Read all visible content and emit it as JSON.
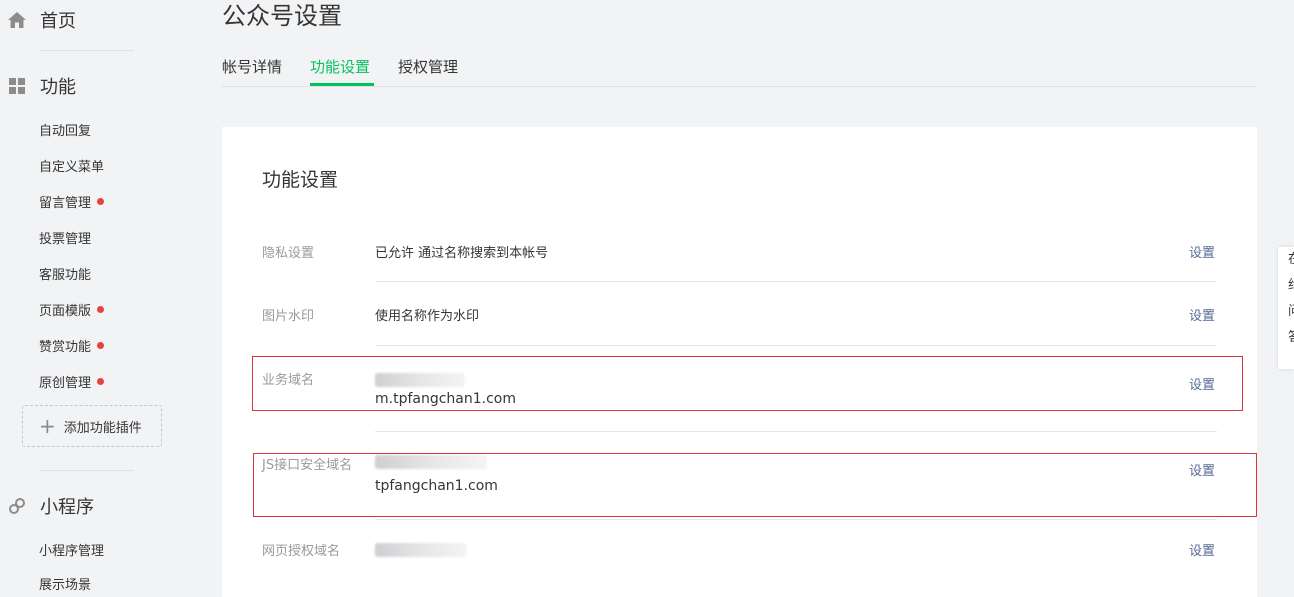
{
  "sidebar": {
    "home": "首页",
    "features": "功能",
    "feature_items": [
      {
        "label": "自动回复",
        "dot": false
      },
      {
        "label": "自定义菜单",
        "dot": false
      },
      {
        "label": "留言管理",
        "dot": true
      },
      {
        "label": "投票管理",
        "dot": false
      },
      {
        "label": "客服功能",
        "dot": false
      },
      {
        "label": "页面模版",
        "dot": true
      },
      {
        "label": "赞赏功能",
        "dot": true
      },
      {
        "label": "原创管理",
        "dot": true
      }
    ],
    "add_plugin": "添加功能插件",
    "miniprogram": "小程序",
    "mini_items": [
      "小程序管理",
      "展示场景"
    ],
    "icons": {
      "home": "home-icon",
      "features": "grid-icon",
      "miniprogram": "link-icon",
      "add": "plus-icon"
    }
  },
  "page": {
    "title": "公众号设置",
    "tabs": [
      "帐号详情",
      "功能设置",
      "授权管理"
    ],
    "active_tab": "功能设置"
  },
  "card": {
    "title": "功能设置",
    "rows": [
      {
        "label": "隐私设置",
        "value": "已允许 通过名称搜索到本帐号",
        "action": "设置"
      },
      {
        "label": "图片水印",
        "value": "使用名称作为水印",
        "action": "设置"
      },
      {
        "label": "业务域名",
        "value": "m.tpfangchan1.com",
        "action": "设置"
      },
      {
        "label": "JS接口安全域名",
        "value": "tpfangchan1.com",
        "action": "设置"
      },
      {
        "label": "网页授权域名",
        "value": "",
        "action": "设置"
      }
    ]
  },
  "side_tip": [
    "在",
    "约",
    "问",
    "答"
  ],
  "colors": {
    "accent": "#07c160",
    "link": "#576b95",
    "dot": "#e64340",
    "highlight_box": "#d9363e"
  }
}
